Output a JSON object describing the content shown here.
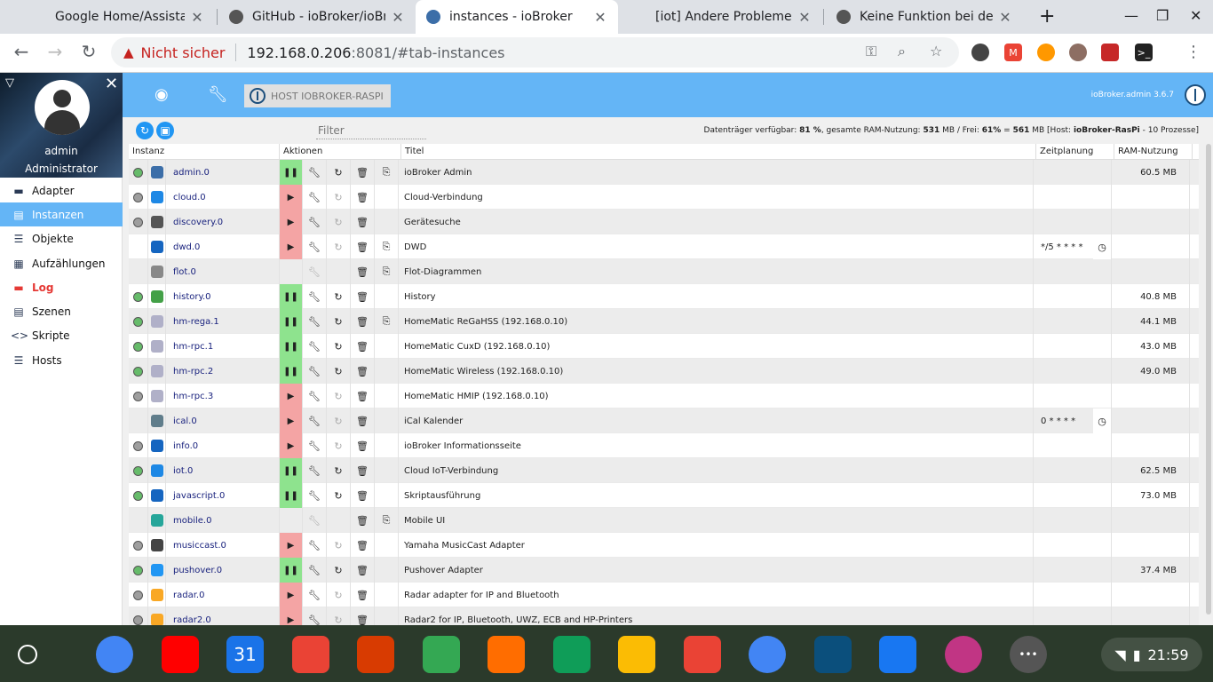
{
  "browser": {
    "tabs": [
      {
        "title": "Google Home/Assistant i",
        "favicon": "google-icon",
        "color": "#4285f4"
      },
      {
        "title": "GitHub - ioBroker/ioBroke",
        "favicon": "github-icon",
        "color": "#24292e"
      },
      {
        "title": "instances - ioBroker",
        "favicon": "gear-icon",
        "color": "#3c6ea8"
      },
      {
        "title": "[iot] Andere Probleme mit",
        "favicon": "forum-icon",
        "color": "#ffffff"
      },
      {
        "title": "Keine Funktion bei der Op",
        "favicon": "github-icon",
        "color": "#24292e"
      }
    ],
    "not_secure": "Nicht sicher",
    "url_host": "192.168.0.206",
    "url_rest": ":8081/#tab-instances"
  },
  "sidebar": {
    "user": "admin",
    "role": "Administrator",
    "items": [
      {
        "label": "Adapter",
        "icon": "store-icon",
        "glyph": "▬"
      },
      {
        "label": "Instanzen",
        "icon": "instances-icon",
        "glyph": "▤"
      },
      {
        "label": "Objekte",
        "icon": "list-icon",
        "glyph": "☰"
      },
      {
        "label": "Aufzählungen",
        "icon": "enum-icon",
        "glyph": "▦"
      },
      {
        "label": "Log",
        "icon": "log-icon",
        "glyph": "▬"
      },
      {
        "label": "Szenen",
        "icon": "scenes-icon",
        "glyph": "▤"
      },
      {
        "label": "Skripte",
        "icon": "code-icon",
        "glyph": "<>"
      },
      {
        "label": "Hosts",
        "icon": "hosts-icon",
        "glyph": "☰"
      }
    ]
  },
  "header": {
    "host": "HOST IOBROKER-RASPI",
    "version": "ioBroker.admin 3.6.7"
  },
  "toolbar": {
    "filter_placeholder": "Filter",
    "status": {
      "prefix": "Datenträger verfügbar: ",
      "disk": "81 %",
      "ram_label": ", gesamte RAM-Nutzung: ",
      "ram_total": "531",
      "free_label": " MB / Frei: ",
      "free_pct": "61%",
      "eq": " = ",
      "free_mb": "561",
      "host_label": " MB [Host: ",
      "host_name": "ioBroker-RasPi",
      "suffix": " - 10 Prozesse]"
    }
  },
  "table": {
    "headers": [
      "Instanz",
      "Aktionen",
      "Titel",
      "Zeitplanung",
      "RAM-Nutzung"
    ],
    "rows": [
      {
        "name": "admin.0",
        "title": "ioBroker Admin",
        "running": true,
        "led": "#66bb6a",
        "icon_color": "#3c6ea8",
        "link": true,
        "sched": "",
        "ram": "60.5 MB"
      },
      {
        "name": "cloud.0",
        "title": "Cloud-Verbindung",
        "running": false,
        "led": "#9e9e9e",
        "icon_color": "#1e88e5",
        "link": false,
        "sched": "",
        "ram": ""
      },
      {
        "name": "discovery.0",
        "title": "Gerätesuche",
        "running": false,
        "led": "#9e9e9e",
        "icon_color": "#555555",
        "link": false,
        "sched": "",
        "ram": ""
      },
      {
        "name": "dwd.0",
        "title": "DWD",
        "running": false,
        "led": "",
        "icon_color": "#1565c0",
        "link": true,
        "sched": "*/5 * * * *",
        "ram": ""
      },
      {
        "name": "flot.0",
        "title": "Flot-Diagrammen",
        "running": null,
        "led": "",
        "icon_color": "#888888",
        "link": true,
        "sched": "",
        "ram": ""
      },
      {
        "name": "history.0",
        "title": "History",
        "running": true,
        "led": "#66bb6a",
        "icon_color": "#43a047",
        "link": false,
        "sched": "",
        "ram": "40.8 MB"
      },
      {
        "name": "hm-rega.1",
        "title": "HomeMatic ReGaHSS (192.168.0.10)",
        "running": true,
        "led": "#66bb6a",
        "icon_color": "#b0b0c8",
        "link": true,
        "sched": "",
        "ram": "44.1 MB"
      },
      {
        "name": "hm-rpc.1",
        "title": "HomeMatic CuxD (192.168.0.10)",
        "running": true,
        "led": "#66bb6a",
        "icon_color": "#b0b0c8",
        "link": false,
        "sched": "",
        "ram": "43.0 MB"
      },
      {
        "name": "hm-rpc.2",
        "title": "HomeMatic Wireless (192.168.0.10)",
        "running": true,
        "led": "#66bb6a",
        "icon_color": "#b0b0c8",
        "link": false,
        "sched": "",
        "ram": "49.0 MB"
      },
      {
        "name": "hm-rpc.3",
        "title": "HomeMatic HMIP (192.168.0.10)",
        "running": false,
        "led": "#9e9e9e",
        "icon_color": "#b0b0c8",
        "link": false,
        "sched": "",
        "ram": ""
      },
      {
        "name": "ical.0",
        "title": "iCal Kalender",
        "running": false,
        "led": "",
        "icon_color": "#607d8b",
        "link": false,
        "sched": "0 * * * *",
        "ram": ""
      },
      {
        "name": "info.0",
        "title": "ioBroker Informationsseite",
        "running": false,
        "led": "#9e9e9e",
        "icon_color": "#1565c0",
        "link": false,
        "sched": "",
        "ram": ""
      },
      {
        "name": "iot.0",
        "title": "Cloud IoT-Verbindung",
        "running": true,
        "led": "#66bb6a",
        "icon_color": "#1e88e5",
        "link": false,
        "sched": "",
        "ram": "62.5 MB"
      },
      {
        "name": "javascript.0",
        "title": "Skriptausführung",
        "running": true,
        "led": "#66bb6a",
        "icon_color": "#1565c0",
        "link": false,
        "sched": "",
        "ram": "73.0 MB"
      },
      {
        "name": "mobile.0",
        "title": "Mobile UI",
        "running": null,
        "led": "",
        "icon_color": "#26a69a",
        "link": true,
        "sched": "",
        "ram": ""
      },
      {
        "name": "musiccast.0",
        "title": "Yamaha MusicCast Adapter",
        "running": false,
        "led": "#9e9e9e",
        "icon_color": "#444444",
        "link": false,
        "sched": "",
        "ram": ""
      },
      {
        "name": "pushover.0",
        "title": "Pushover Adapter",
        "running": true,
        "led": "#66bb6a",
        "icon_color": "#2196f3",
        "link": false,
        "sched": "",
        "ram": "37.4 MB"
      },
      {
        "name": "radar.0",
        "title": "Radar adapter for IP and Bluetooth",
        "running": false,
        "led": "#9e9e9e",
        "icon_color": "#f9a825",
        "link": false,
        "sched": "",
        "ram": ""
      },
      {
        "name": "radar2.0",
        "title": "Radar2 for IP, Bluetooth, UWZ, ECB and HP-Printers",
        "running": false,
        "led": "#9e9e9e",
        "icon_color": "#f9a825",
        "link": false,
        "sched": "",
        "ram": ""
      }
    ]
  },
  "shelf": {
    "apps": [
      {
        "name": "chrome-icon",
        "color": "#4285f4"
      },
      {
        "name": "youtube-icon",
        "color": "#ff0000"
      },
      {
        "name": "calendar-icon",
        "color": "#1a73e8",
        "label": "31"
      },
      {
        "name": "gmail-icon",
        "color": "#ea4335"
      },
      {
        "name": "office-icon",
        "color": "#d83b01"
      },
      {
        "name": "maps-icon",
        "color": "#34a853"
      },
      {
        "name": "play-music-icon",
        "color": "#ff6d00"
      },
      {
        "name": "drive-icon",
        "color": "#0f9d58"
      },
      {
        "name": "keep-icon",
        "color": "#fbbc04"
      },
      {
        "name": "photos-icon",
        "color": "#ea4335"
      },
      {
        "name": "palette-icon",
        "color": "#4285f4"
      },
      {
        "name": "raspberry-icon",
        "color": "#0b4f7c"
      },
      {
        "name": "facebook-icon",
        "color": "#1877f2"
      },
      {
        "name": "instagram-icon",
        "color": "#c13584"
      },
      {
        "name": "more-icon",
        "color": "#555555"
      }
    ],
    "clock": "21:59"
  }
}
